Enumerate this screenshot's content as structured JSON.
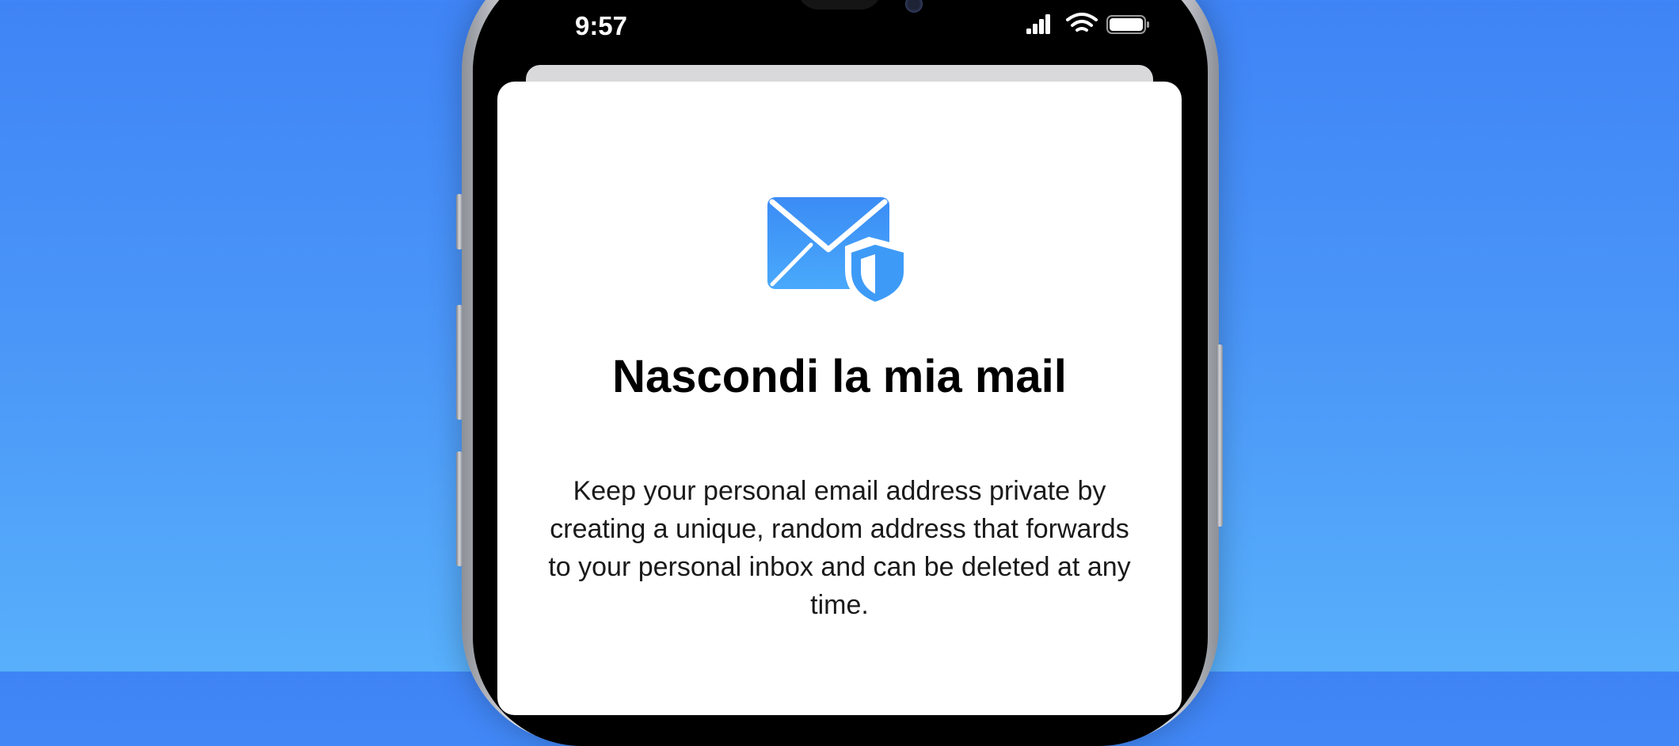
{
  "status_bar": {
    "time": "9:57",
    "icons": [
      "cellular-signal-icon",
      "wifi-icon",
      "battery-icon"
    ]
  },
  "sheet": {
    "icon": "hide-my-email-icon",
    "title": "Nascondi la mia mail",
    "description": "Keep your personal email address private by creating a unique, random address that forwards to your personal inbox and can be deleted at any time."
  },
  "colors": {
    "background_top": "#3f84f6",
    "background_bottom": "#58b0fb",
    "icon_blue": "#3d9bf7",
    "sheet_background": "#ffffff"
  }
}
